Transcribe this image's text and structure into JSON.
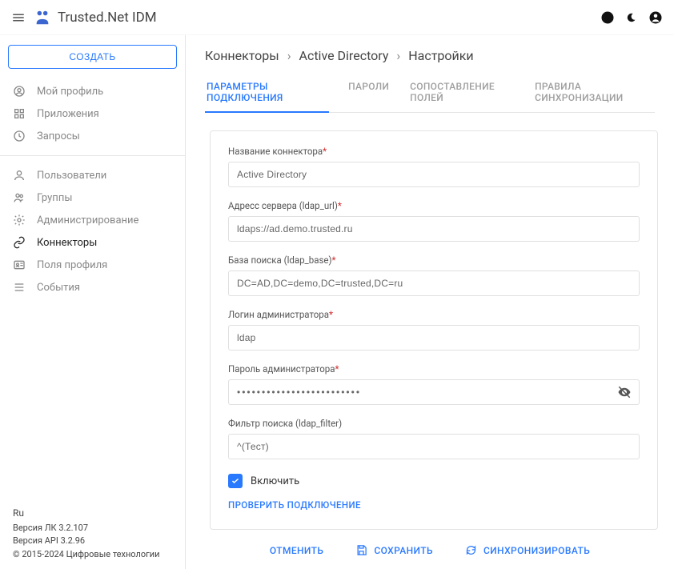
{
  "header": {
    "title": "Trusted.Net IDM"
  },
  "sidebar": {
    "create_label": "СОЗДАТЬ",
    "group1": [
      {
        "label": "Мой профиль"
      },
      {
        "label": "Приложения"
      },
      {
        "label": "Запросы"
      }
    ],
    "group2": [
      {
        "label": "Пользователи"
      },
      {
        "label": "Группы"
      },
      {
        "label": "Администрирование"
      },
      {
        "label": "Коннекторы"
      },
      {
        "label": "Поля профиля"
      },
      {
        "label": "События"
      }
    ],
    "footer": {
      "lang": "Ru",
      "version_lk": "Версия ЛК 3.2.107",
      "version_api": "Версия API 3.2.96",
      "copyright": "© 2015-2024 Цифровые технологии"
    }
  },
  "breadcrumb": {
    "item1": "Коннекторы",
    "item2": "Active Directory",
    "item3": "Настройки",
    "chevron": "›"
  },
  "tabs": {
    "t1": "ПАРАМЕТРЫ ПОДКЛЮЧЕНИЯ",
    "t2": "ПАРОЛИ",
    "t3": "СОПОСТАВЛЕНИЕ ПОЛЕЙ",
    "t4": "ПРАВИЛА СИНХРОНИЗАЦИИ"
  },
  "form": {
    "name_label": "Название коннектора",
    "name_value": "Active Directory",
    "url_label": "Адресс сервера (ldap_url)",
    "url_value": "ldaps://ad.demo.trusted.ru",
    "base_label": "База поиска (ldap_base)",
    "base_value": "DC=AD,DC=demo,DC=trusted,DC=ru",
    "login_label": "Логин администратора",
    "login_value": "ldap",
    "password_label": "Пароль администратора",
    "password_value": "•••••••••••••••••••••••••",
    "filter_label": "Фильтр поиска (ldap_filter)",
    "filter_value": "^(Тест)",
    "enable_label": "Включить",
    "test_connection": "ПРОВЕРИТЬ ПОДКЛЮЧЕНИЕ",
    "required_mark": "*"
  },
  "actions": {
    "cancel": "ОТМЕНИТЬ",
    "save": "СОХРАНИТЬ",
    "sync": "СИНХРОНИЗИРОВАТЬ"
  }
}
